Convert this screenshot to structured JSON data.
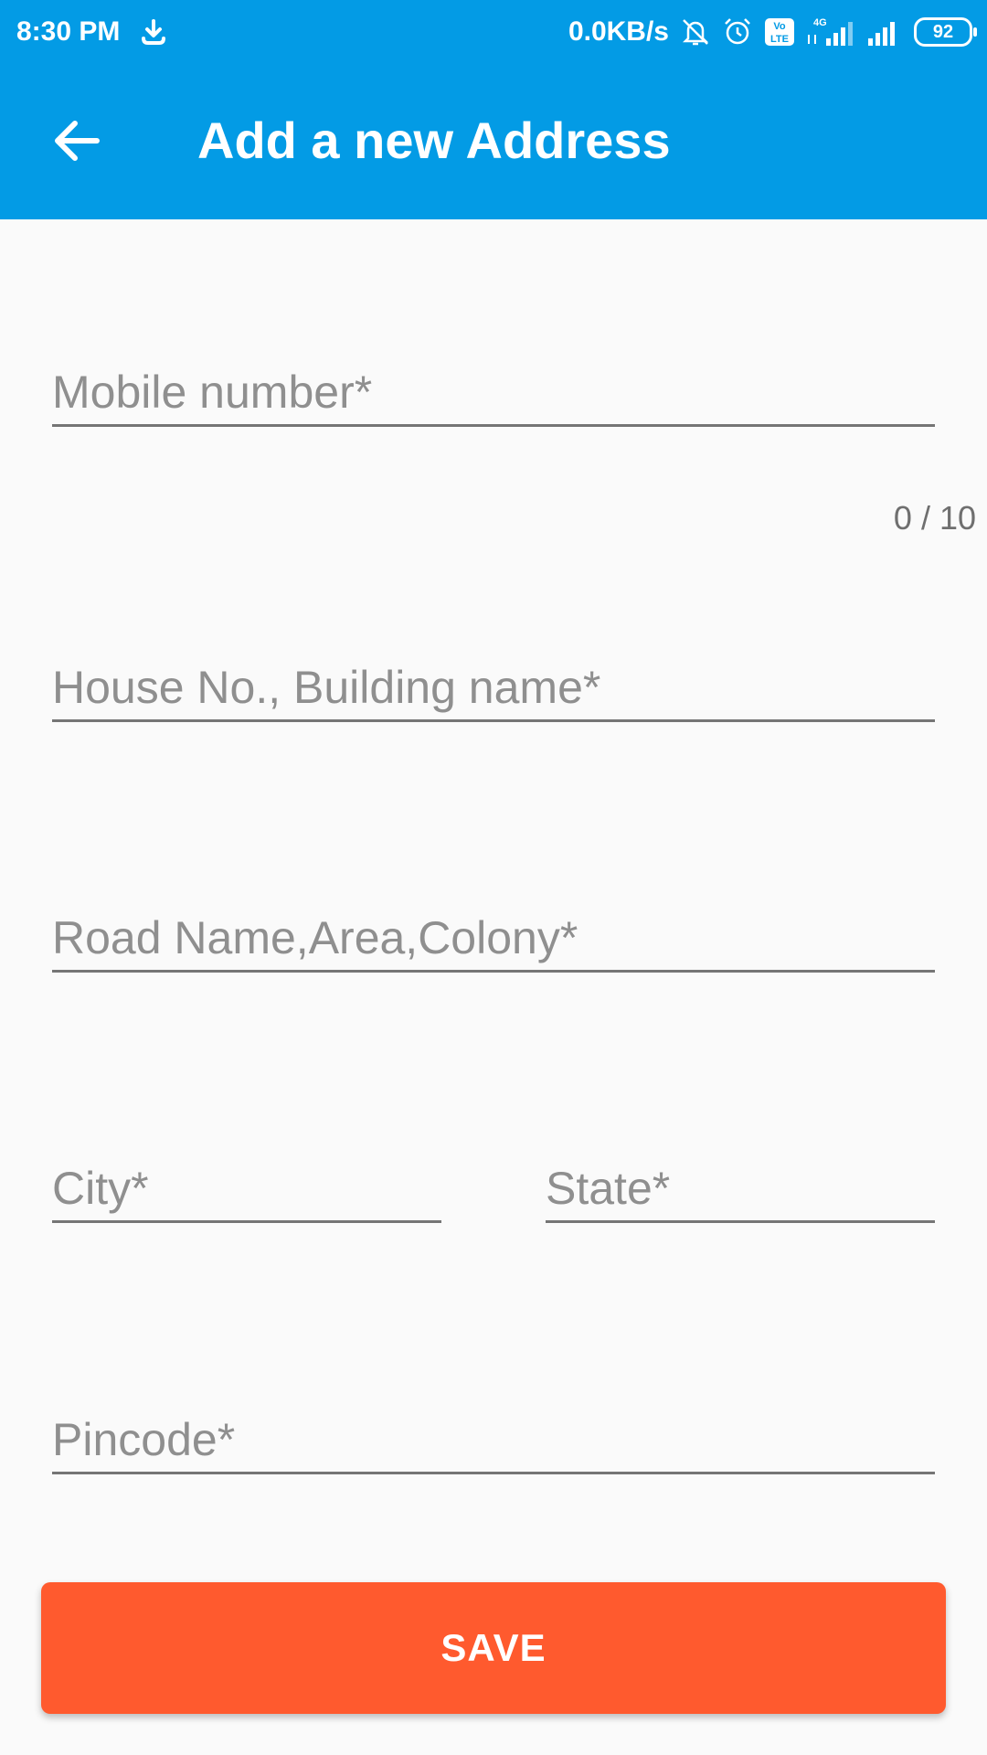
{
  "status_bar": {
    "time": "8:30 PM",
    "net_speed": "0.0KB/s",
    "volte": "Vo\nLTE",
    "network_type": "4G",
    "battery": "92",
    "icons": [
      "download-icon",
      "bell-off-icon",
      "alarm-icon",
      "volte-icon",
      "signal-4g-icon",
      "signal-icon",
      "battery-icon"
    ]
  },
  "toolbar": {
    "title": "Add a new Address",
    "back_icon": "arrow-back-icon"
  },
  "form": {
    "mobile": {
      "placeholder": "Mobile number*",
      "value": "",
      "counter": "0 / 10"
    },
    "house": {
      "placeholder": "House No., Building name*",
      "value": ""
    },
    "road": {
      "placeholder": "Road Name,Area,Colony*",
      "value": ""
    },
    "city": {
      "placeholder": "City*",
      "value": ""
    },
    "state": {
      "placeholder": "State*",
      "value": ""
    },
    "pincode": {
      "placeholder": "Pincode*",
      "value": ""
    }
  },
  "save_button": {
    "label": "SAVE"
  },
  "colors": {
    "appbar": "#039be5",
    "accent": "#ff5a2e",
    "background": "#fafafa"
  }
}
